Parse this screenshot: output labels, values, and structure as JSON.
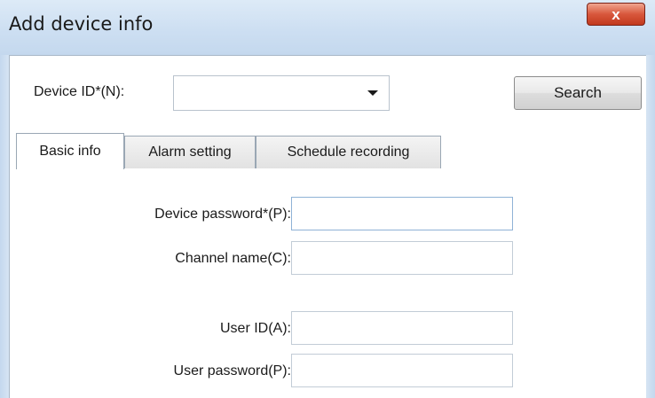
{
  "window": {
    "title": "Add device info",
    "close_label": "x"
  },
  "device_id": {
    "label": "Device ID*(N):",
    "value": ""
  },
  "search_button": "Search",
  "tabs": [
    {
      "label": "Basic info",
      "active": true
    },
    {
      "label": "Alarm setting",
      "active": false
    },
    {
      "label": "Schedule recording",
      "active": false
    }
  ],
  "basic_info": {
    "device_password_label": "Device password*(P):",
    "channel_name_label": "Channel name(C):",
    "user_id_label": "User ID(A):",
    "user_password_label": "User password(P):"
  },
  "colors": {
    "titlebar": "#cddff2",
    "close_button": "#d8573c"
  }
}
